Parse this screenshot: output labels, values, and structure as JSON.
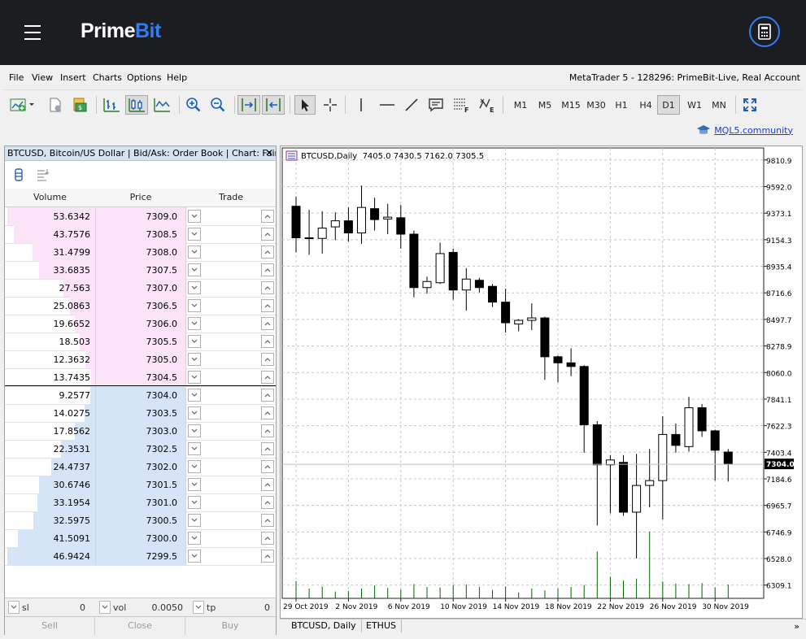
{
  "brand": {
    "part1": "Prime",
    "part2": "Bit"
  },
  "menu": [
    "File",
    "View",
    "Insert",
    "Charts",
    "Options",
    "Help"
  ],
  "account_title": "MetaTrader 5 - 128296: PrimeBit-Live, Real Account",
  "timeframes": [
    "M1",
    "M5",
    "M15",
    "M30",
    "H1",
    "H4",
    "D1",
    "W1",
    "MN"
  ],
  "active_timeframe": "D1",
  "mql_link": "MQL5.community",
  "panel": {
    "title": "BTCUSD, Bitcoin/US Dollar | Bid/Ask: Order Book | Chart: Fair...",
    "headers": {
      "volume": "Volume",
      "price": "Price",
      "trade": "Trade"
    },
    "asks": [
      {
        "volume": "53.6342",
        "price": "7309.0",
        "depth": 1.0
      },
      {
        "volume": "43.7576",
        "price": "7308.5",
        "depth": 0.93
      },
      {
        "volume": "31.4799",
        "price": "7308.0",
        "depth": 0.71
      },
      {
        "volume": "33.6835",
        "price": "7307.5",
        "depth": 0.64
      },
      {
        "volume": "27.563",
        "price": "7307.0",
        "depth": 0.36
      },
      {
        "volume": "25.0863",
        "price": "7306.5",
        "depth": 0.29
      },
      {
        "volume": "19.6652",
        "price": "7306.0",
        "depth": 0.23
      },
      {
        "volume": "18.503",
        "price": "7305.5",
        "depth": 0.18
      },
      {
        "volume": "12.3632",
        "price": "7305.0",
        "depth": 0.11
      },
      {
        "volume": "13.7435",
        "price": "7304.5",
        "depth": 0.05
      }
    ],
    "bids": [
      {
        "volume": "9.2577",
        "price": "7304.0",
        "depth": 0.06
      },
      {
        "volume": "14.0275",
        "price": "7303.5",
        "depth": 0.12
      },
      {
        "volume": "17.8562",
        "price": "7303.0",
        "depth": 0.23
      },
      {
        "volume": "22.3531",
        "price": "7302.5",
        "depth": 0.39
      },
      {
        "volume": "24.4737",
        "price": "7302.0",
        "depth": 0.5
      },
      {
        "volume": "30.6746",
        "price": "7301.5",
        "depth": 0.64
      },
      {
        "volume": "33.1954",
        "price": "7301.0",
        "depth": 0.66
      },
      {
        "volume": "32.5975",
        "price": "7300.5",
        "depth": 0.7
      },
      {
        "volume": "41.5091",
        "price": "7300.0",
        "depth": 0.88
      },
      {
        "volume": "46.9424",
        "price": "7299.5",
        "depth": 1.0
      }
    ],
    "sl": {
      "label": "sl",
      "value": "0"
    },
    "vol": {
      "label": "vol",
      "value": "0.0050"
    },
    "tp": {
      "label": "tp",
      "value": "0"
    },
    "buttons": {
      "sell": "Sell",
      "close": "Close",
      "buy": "Buy"
    }
  },
  "chart_header": "BTCUSD,Daily  7405.0 7430.5 7162.0 7305.5",
  "current_price": "7304.0",
  "current_price_value": 7304.0,
  "colors": {
    "ask": "#fbe3f8",
    "bid": "#d6e4f8",
    "volume_bar": "#006400",
    "accent": "#2f7ef2"
  },
  "tabs": [
    "BTCUSD, Daily",
    "ETHUS"
  ],
  "chart_data": {
    "type": "candlestick",
    "ylim": [
      6200,
      9910
    ],
    "y_ticks": [
      "9810.9",
      "9592.0",
      "9373.1",
      "9154.3",
      "8935.4",
      "8716.6",
      "8497.7",
      "8278.9",
      "8060.0",
      "7841.1",
      "7622.3",
      "7403.4",
      "7184.6",
      "6965.7",
      "6746.9",
      "6528.0",
      "6309.1"
    ],
    "y_tick_values": [
      9810.9,
      9592.0,
      9373.1,
      9154.3,
      8935.4,
      8716.6,
      8497.7,
      8278.9,
      8060.0,
      7841.1,
      7622.3,
      7403.4,
      7184.6,
      6965.7,
      6746.9,
      6528.0,
      6309.1
    ],
    "x_labels": [
      "29 Oct 2019",
      "2 Nov 2019",
      "6 Nov 2019",
      "10 Nov 2019",
      "14 Nov 2019",
      "18 Nov 2019",
      "22 Nov 2019",
      "26 Nov 2019",
      "30 Nov 2019"
    ],
    "x_label_index": [
      0,
      4,
      8,
      12,
      16,
      20,
      24,
      28,
      32
    ],
    "candles": [
      {
        "o": 9430,
        "h": 9510,
        "l": 9050,
        "c": 9170
      },
      {
        "o": 9170,
        "h": 9400,
        "l": 9030,
        "c": 9170
      },
      {
        "o": 9165,
        "h": 9390,
        "l": 9040,
        "c": 9250
      },
      {
        "o": 9260,
        "h": 9380,
        "l": 9150,
        "c": 9310
      },
      {
        "o": 9310,
        "h": 9420,
        "l": 9140,
        "c": 9210
      },
      {
        "o": 9210,
        "h": 9600,
        "l": 9120,
        "c": 9420
      },
      {
        "o": 9410,
        "h": 9500,
        "l": 9230,
        "c": 9320
      },
      {
        "o": 9325,
        "h": 9450,
        "l": 9200,
        "c": 9340
      },
      {
        "o": 9335,
        "h": 9440,
        "l": 9080,
        "c": 9200
      },
      {
        "o": 9200,
        "h": 9230,
        "l": 8680,
        "c": 8760
      },
      {
        "o": 8760,
        "h": 8850,
        "l": 8710,
        "c": 8810
      },
      {
        "o": 8800,
        "h": 9130,
        "l": 8790,
        "c": 9040
      },
      {
        "o": 9050,
        "h": 9080,
        "l": 8660,
        "c": 8740
      },
      {
        "o": 8740,
        "h": 8920,
        "l": 8570,
        "c": 8830
      },
      {
        "o": 8820,
        "h": 8840,
        "l": 8720,
        "c": 8760
      },
      {
        "o": 8770,
        "h": 8790,
        "l": 8600,
        "c": 8640
      },
      {
        "o": 8640,
        "h": 8750,
        "l": 8390,
        "c": 8470
      },
      {
        "o": 8460,
        "h": 8500,
        "l": 8400,
        "c": 8490
      },
      {
        "o": 8490,
        "h": 8630,
        "l": 8410,
        "c": 8510
      },
      {
        "o": 8510,
        "h": 8520,
        "l": 8000,
        "c": 8190
      },
      {
        "o": 8190,
        "h": 8200,
        "l": 7980,
        "c": 8140
      },
      {
        "o": 8140,
        "h": 8260,
        "l": 8030,
        "c": 8110
      },
      {
        "o": 8110,
        "h": 8120,
        "l": 7400,
        "c": 7630
      },
      {
        "o": 7630,
        "h": 7660,
        "l": 6800,
        "c": 7300
      },
      {
        "o": 7300,
        "h": 7380,
        "l": 6900,
        "c": 7340
      },
      {
        "o": 7320,
        "h": 7380,
        "l": 6880,
        "c": 6910
      },
      {
        "o": 6910,
        "h": 7390,
        "l": 6530,
        "c": 7130
      },
      {
        "o": 7130,
        "h": 7430,
        "l": 6950,
        "c": 7170
      },
      {
        "o": 7170,
        "h": 7700,
        "l": 6850,
        "c": 7550
      },
      {
        "o": 7550,
        "h": 7640,
        "l": 7400,
        "c": 7460
      },
      {
        "o": 7450,
        "h": 7860,
        "l": 7410,
        "c": 7770
      },
      {
        "o": 7770,
        "h": 7800,
        "l": 7530,
        "c": 7580
      },
      {
        "o": 7580,
        "h": 7590,
        "l": 7170,
        "c": 7420
      },
      {
        "o": 7405,
        "h": 7430,
        "l": 7162,
        "c": 7305.5
      }
    ],
    "volumes": [
      35,
      20,
      24,
      14,
      15,
      20,
      26,
      21,
      18,
      29,
      23,
      22,
      27,
      28,
      23,
      17,
      24,
      12,
      20,
      16,
      20,
      23,
      27,
      95,
      44,
      36,
      40,
      135,
      34,
      30,
      29,
      31,
      22,
      28
    ],
    "volume_max": 135
  }
}
